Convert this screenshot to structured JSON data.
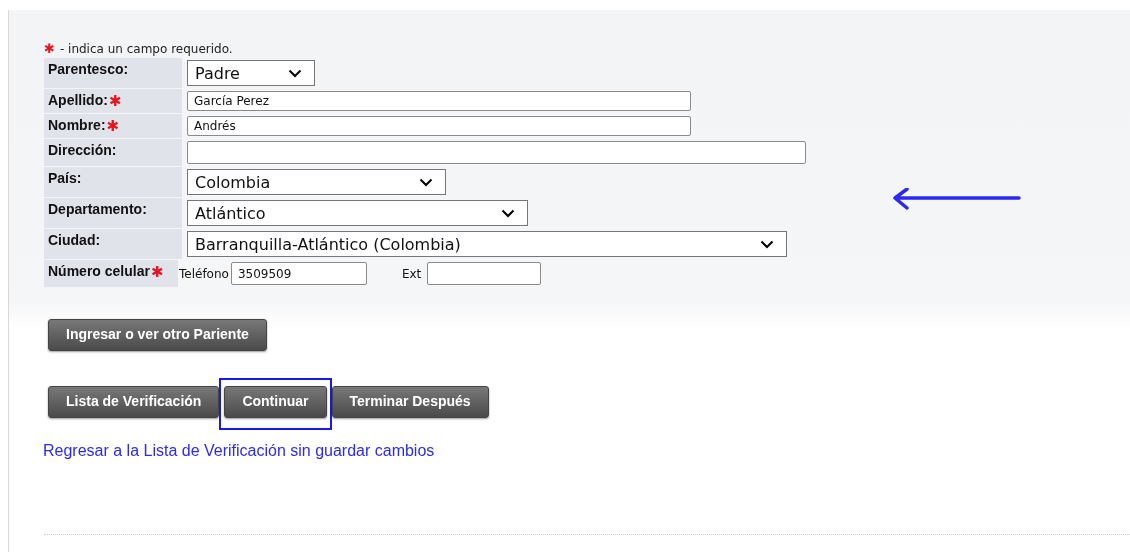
{
  "legend": {
    "mark": "✱",
    "text": "- indica un campo requerido."
  },
  "fields": [
    {
      "label": "Parentesco:",
      "kind": "select",
      "value": "Padre"
    },
    {
      "label": "Apellido:",
      "mark": "✱",
      "kind": "text",
      "value": "García Perez"
    },
    {
      "label": "Nombre:",
      "mark": "✱",
      "kind": "text",
      "value": "Andrés"
    },
    {
      "label": "Dirección:",
      "kind": "text"
    },
    {
      "label": "País:",
      "kind": "select",
      "value": "Colombia"
    },
    {
      "label": "Departamento:",
      "kind": "select",
      "value": "Atlántico"
    },
    {
      "label": "Ciudad:",
      "kind": "select",
      "value": "Barranquilla-Atlántico (Colombia)"
    },
    {
      "label": "Número celular",
      "mark": "✱",
      "kind": "phone",
      "phone_label": "Teléfono",
      "value": "3509509",
      "ext_label": "Ext"
    }
  ],
  "relative_button": {
    "label": "Ingresar o ver otro Pariente",
    "highlighted": false
  },
  "buttons": [
    {
      "label": "Lista de Verificación",
      "highlighted": false
    },
    {
      "label": "Continuar",
      "highlighted": true
    },
    {
      "label": "Terminar Después",
      "highlighted": false
    }
  ],
  "back_link": "Regresar a la Lista de Verificación sin guardar cambios",
  "annotations": [
    {
      "kind": "arrow"
    }
  ]
}
